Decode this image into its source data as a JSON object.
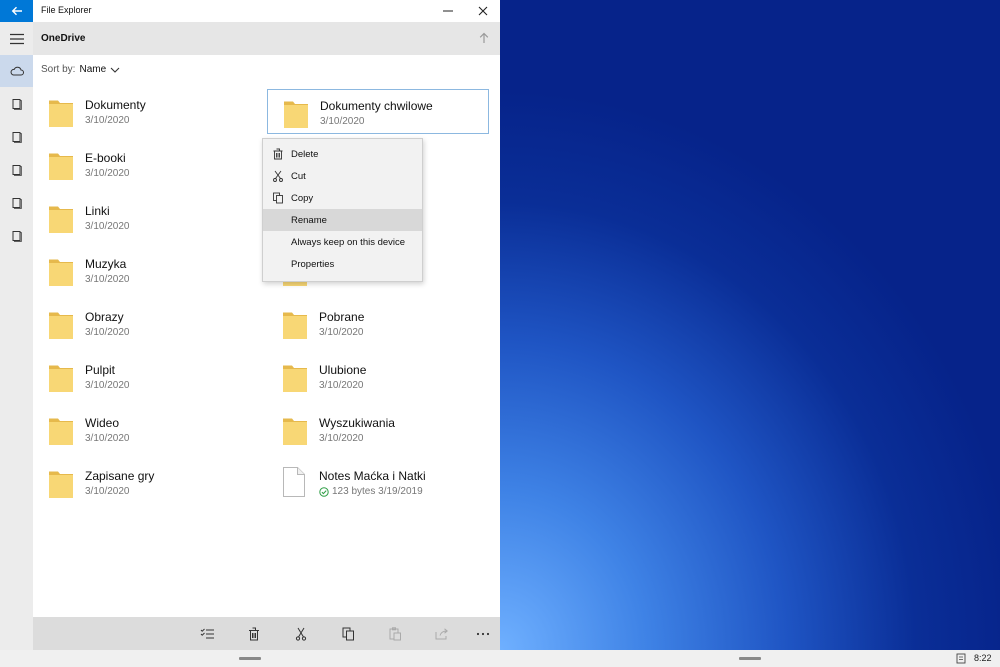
{
  "window": {
    "title": "File Explorer",
    "location": "OneDrive",
    "sort_label": "Sort by:",
    "sort_value": "Name"
  },
  "items": [
    {
      "name": "Dokumenty",
      "meta": "3/10/2020",
      "type": "folder",
      "selected": false
    },
    {
      "name": "Dokumenty chwilowe",
      "meta": "3/10/2020",
      "type": "folder",
      "selected": true
    },
    {
      "name": "E-booki",
      "meta": "3/10/2020",
      "type": "folder",
      "selected": false
    },
    {
      "name": "",
      "meta": "",
      "type": "folder",
      "selected": false
    },
    {
      "name": "Linki",
      "meta": "3/10/2020",
      "type": "folder",
      "selected": false
    },
    {
      "name": "",
      "meta": "",
      "type": "folder",
      "selected": false
    },
    {
      "name": "Muzyka",
      "meta": "3/10/2020",
      "type": "folder",
      "selected": false
    },
    {
      "name": "",
      "meta": "",
      "type": "folder",
      "selected": false
    },
    {
      "name": "Obrazy",
      "meta": "3/10/2020",
      "type": "folder",
      "selected": false
    },
    {
      "name": "Pobrane",
      "meta": "3/10/2020",
      "type": "folder",
      "selected": false
    },
    {
      "name": "Pulpit",
      "meta": "3/10/2020",
      "type": "folder",
      "selected": false
    },
    {
      "name": "Ulubione",
      "meta": "3/10/2020",
      "type": "folder",
      "selected": false
    },
    {
      "name": "Wideo",
      "meta": "3/10/2020",
      "type": "folder",
      "selected": false
    },
    {
      "name": "Wyszukiwania",
      "meta": "3/10/2020",
      "type": "folder",
      "selected": false
    },
    {
      "name": "Zapisane gry",
      "meta": "3/10/2020",
      "type": "folder",
      "selected": false
    },
    {
      "name": "Notes Maćka i Natki",
      "meta": "123 bytes 3/19/2019",
      "type": "file",
      "selected": false,
      "synced": true
    }
  ],
  "context_menu": {
    "items": [
      {
        "label": "Delete",
        "icon": "trash-icon"
      },
      {
        "label": "Cut",
        "icon": "scissors-icon"
      },
      {
        "label": "Copy",
        "icon": "copy-icon"
      },
      {
        "label": "Rename",
        "icon": "",
        "highlighted": true
      },
      {
        "label": "Always keep on this device",
        "icon": ""
      },
      {
        "label": "Properties",
        "icon": ""
      }
    ]
  },
  "taskbar": {
    "time": "8:22"
  },
  "colors": {
    "accent": "#0078d7",
    "folder": "#f8d775",
    "folder_tab": "#e6b94c",
    "selection_border": "#8cb8e0",
    "sync_ok": "#2e9e45"
  }
}
